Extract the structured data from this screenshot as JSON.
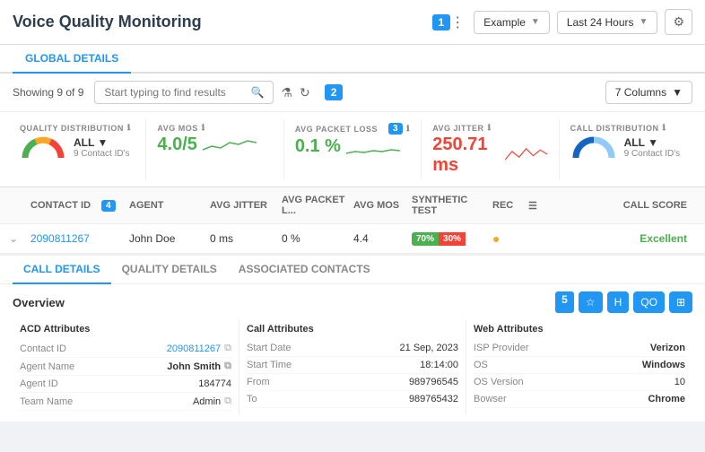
{
  "header": {
    "title": "Voice Quality Monitoring",
    "badge": "1",
    "dropdowns": {
      "example": "Example",
      "time": "Last 24 Hours"
    }
  },
  "tabs": {
    "global": "GLOBAL DETAILS"
  },
  "toolbar": {
    "showing": "Showing 9 of 9",
    "search_placeholder": "Start typing to find results",
    "badge": "2",
    "columns_label": "7 Columns"
  },
  "stats": [
    {
      "label": "QUALITY DISTRIBUTION",
      "value": "ALL",
      "sub": "9 Contact ID's",
      "type": "gauge"
    },
    {
      "label": "AVG MOS",
      "value": "4.0/5",
      "type": "number",
      "color": "green"
    },
    {
      "label": "AVG PACKET LOSS",
      "badge": "3",
      "value": "0.1 %",
      "type": "number",
      "color": "green"
    },
    {
      "label": "AVG JITTER",
      "value": "250.71 ms",
      "type": "number",
      "color": "red"
    },
    {
      "label": "CALL DISTRIBUTION",
      "value": "ALL",
      "sub": "9 Contact ID's",
      "type": "gauge2"
    }
  ],
  "table": {
    "columns": [
      "",
      "CONTACT ID",
      "AGENT",
      "AVG JITTER",
      "AVG PACKET L...",
      "AVG MOS",
      "SYNTHETIC TEST",
      "REC",
      "",
      "CALL SCORE"
    ],
    "badge": "4",
    "rows": [
      {
        "contact_id": "2090811267",
        "agent": "John Doe",
        "avg_jitter": "0 ms",
        "avg_packet": "0 %",
        "avg_mos": "4.4",
        "synthetic_green": "70%",
        "synthetic_red": "30%",
        "rec": "●",
        "call_score": "Excellent"
      }
    ]
  },
  "detail_tabs": [
    "CALL DETAILS",
    "QUALITY DETAILS",
    "ASSOCIATED CONTACTS"
  ],
  "detail": {
    "overview_title": "Overview",
    "badge": "5",
    "acd": {
      "title": "ACD Attributes",
      "rows": [
        {
          "key": "Contact ID",
          "val": "2090811267",
          "link": true
        },
        {
          "key": "Agent Name",
          "val": "John Smith"
        },
        {
          "key": "Agent ID",
          "val": "184774"
        },
        {
          "key": "Team Name",
          "val": "Admin"
        }
      ]
    },
    "call": {
      "title": "Call Attributes",
      "rows": [
        {
          "key": "Start Date",
          "val": "21 Sep, 2023"
        },
        {
          "key": "Start Time",
          "val": "18:14:00"
        },
        {
          "key": "From",
          "val": "989796545"
        },
        {
          "key": "To",
          "val": "989765432"
        }
      ]
    },
    "web": {
      "title": "Web  Attributes",
      "rows": [
        {
          "key": "ISP Provider",
          "val": "Verizon"
        },
        {
          "key": "OS",
          "val": "Windows"
        },
        {
          "key": "OS Version",
          "val": "10"
        },
        {
          "key": "Bowser",
          "val": "Chrome"
        }
      ]
    }
  }
}
